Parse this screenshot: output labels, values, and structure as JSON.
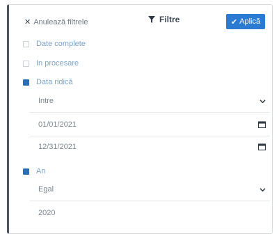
{
  "toolbar": {
    "clear_label": "Anulează filtrele",
    "title": "Filtre",
    "apply_label": "Aplică"
  },
  "options": [
    {
      "label": "Date complete",
      "checked": false
    },
    {
      "label": "In procesare",
      "checked": false
    },
    {
      "label": "Data ridică",
      "checked": true
    }
  ],
  "date_filter": {
    "operator": "Intre",
    "from": "01/01/2021",
    "to": "12/31/2021"
  },
  "year_option": {
    "label": "An",
    "checked": true
  },
  "year_filter": {
    "operator": "Egal",
    "value": "2020"
  },
  "colors": {
    "accent": "#2a7bd1",
    "checked_box": "#2a6fb8",
    "option_text": "#7da3c8"
  }
}
